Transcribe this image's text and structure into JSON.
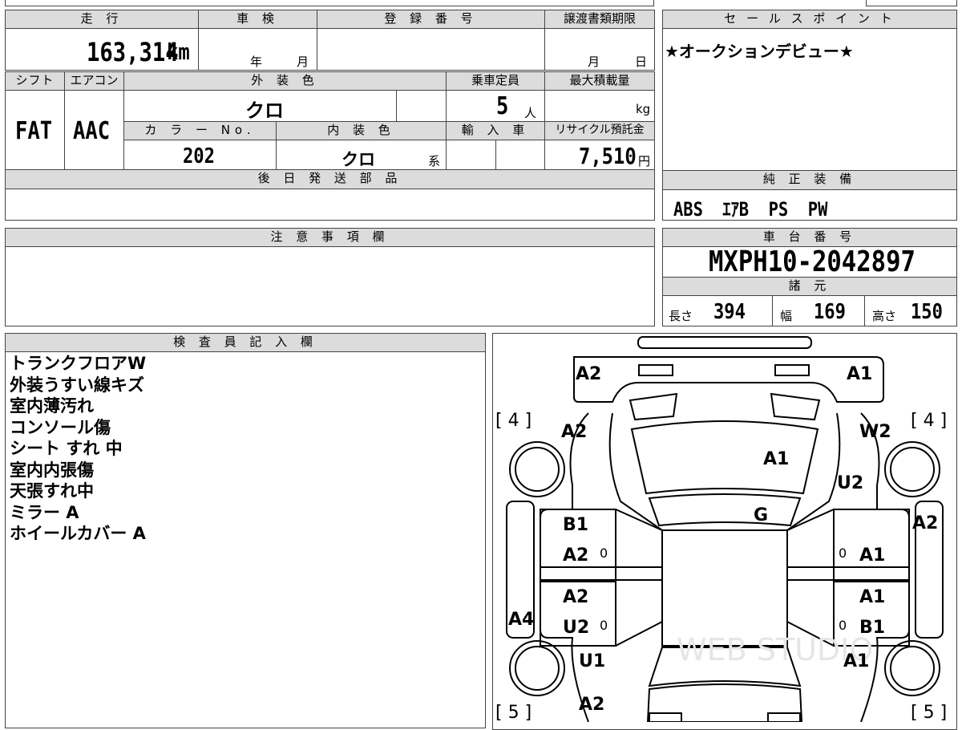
{
  "top_section": {
    "mileage_label": "走 行",
    "mileage_value": "163,314",
    "mileage_unit": "km",
    "inspection_label": "車 検",
    "inspection_year": "年",
    "inspection_month": "月",
    "registration_label": "登 録 番 号",
    "transfer_deadline_label": "譲渡書類期限",
    "transfer_month": "月",
    "transfer_day": "日",
    "shift_label": "シフト",
    "aircon_label": "エアコン",
    "shift_value": "FAT",
    "aircon_value": "AAC",
    "exterior_color_label": "外 装 色",
    "exterior_color_value": "クロ",
    "capacity_label": "乗車定員",
    "capacity_value": "5",
    "capacity_unit": "人",
    "max_load_label": "最大積載量",
    "max_load_unit": "kg",
    "color_no_label": "カ ラ ー No.",
    "color_no_value": "202",
    "interior_color_label": "内 装 色",
    "interior_color_value": "クロ",
    "interior_color_suffix": "系",
    "import_label": "輸 入 車",
    "recycle_label": "リサイクル預託金",
    "recycle_value": "7,510",
    "recycle_unit": "円",
    "later_parts_label": "後 日 発 送 部 品"
  },
  "sales_points": {
    "label": "セ ー ル ス ポ イ ン ト",
    "value": "★オークションデビュー★"
  },
  "standard_equipment": {
    "label": "純 正 装 備",
    "value": "ABS  ｴｱB  PS  PW"
  },
  "notes": {
    "label": "注 意 事 項 欄"
  },
  "chassis": {
    "label": "車 台 番 号",
    "value": "MXPH10-2042897"
  },
  "specs": {
    "label": "諸 元",
    "length_label": "長さ",
    "length_value": "394",
    "width_label": "幅",
    "width_value": "169",
    "height_label": "高さ",
    "height_value": "150"
  },
  "inspector": {
    "label": "検 査 員 記 入 欄",
    "remarks": [
      "トランクフロアW",
      "外装うすい線キズ",
      "室内薄汚れ",
      "コンソール傷",
      "シート すれ 中",
      "室内内張傷",
      "天張すれ中",
      "ミラー A",
      "ホイールカバー A"
    ]
  },
  "diagram": {
    "rear_left": "A2",
    "rear_right": "A1",
    "tire_rear_left": "[ 4 ]",
    "tire_rear_right": "[ 4 ]",
    "rear_quarter_left": "A2",
    "rear_quarter_right": "W2",
    "rear_glass": "A1",
    "quarter_right_lower": "U2",
    "roof": "G",
    "right_step": "A2",
    "left_step": "A4",
    "rear_door_left_1": "B1",
    "rear_door_left_2": "A2",
    "rear_door_right": "A1",
    "front_door_left_1": "A2",
    "front_door_left_2": "U2",
    "front_door_right_1": "A1",
    "front_door_right_2": "B1",
    "fender_left": "U1",
    "fender_right": "A1",
    "front_left": "A2",
    "tire_front_left": "[ 5 ]",
    "tire_front_right": "[ 5 ]",
    "zero_mark": "0",
    "watermark": "WEB STUDIO"
  }
}
